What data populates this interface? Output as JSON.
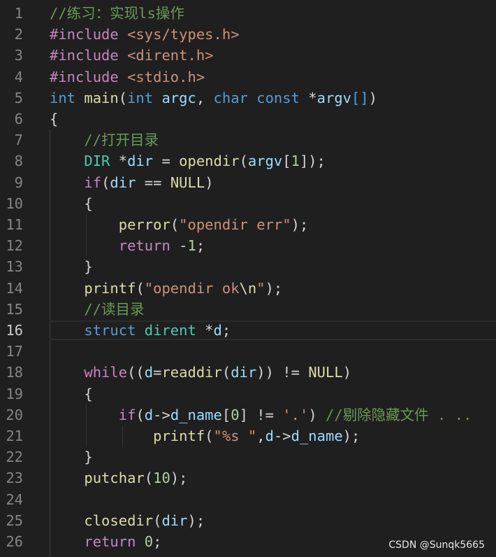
{
  "colors": {
    "background": "#1f1f1f",
    "line_number": "#858585",
    "active_line_number": "#cccccc",
    "comment": "#6a9955",
    "preprocessor": "#c586c0",
    "include_path": "#ce9178",
    "type_keyword": "#569cd6",
    "function": "#dcdcaa",
    "variable": "#9cdcfe",
    "string": "#ce9178",
    "number": "#b5cea8",
    "control_keyword": "#c586c0",
    "type_name": "#4ec9b0",
    "default_text": "#d4d4d4"
  },
  "current_line": 16,
  "watermark": "CSDN @Sunqk5665",
  "lines": [
    {
      "number": "1",
      "tokens": [
        {
          "t": "//练习：实现ls操作",
          "c": "comment"
        }
      ]
    },
    {
      "number": "2",
      "tokens": [
        {
          "t": "#include",
          "c": "preprocessor"
        },
        {
          "t": " ",
          "c": "default_text"
        },
        {
          "t": "<sys/types.h>",
          "c": "include_path"
        }
      ]
    },
    {
      "number": "3",
      "tokens": [
        {
          "t": "#include",
          "c": "preprocessor"
        },
        {
          "t": " ",
          "c": "default_text"
        },
        {
          "t": "<dirent.h>",
          "c": "include_path"
        }
      ]
    },
    {
      "number": "4",
      "tokens": [
        {
          "t": "#include",
          "c": "preprocessor"
        },
        {
          "t": " ",
          "c": "default_text"
        },
        {
          "t": "<stdio.h>",
          "c": "include_path"
        }
      ]
    },
    {
      "number": "5",
      "tokens": [
        {
          "t": "int",
          "c": "type_keyword"
        },
        {
          "t": " ",
          "c": "default_text"
        },
        {
          "t": "main",
          "c": "function"
        },
        {
          "t": "(",
          "c": "default_text"
        },
        {
          "t": "int",
          "c": "type_keyword"
        },
        {
          "t": " ",
          "c": "default_text"
        },
        {
          "t": "argc",
          "c": "variable"
        },
        {
          "t": ", ",
          "c": "default_text"
        },
        {
          "t": "char",
          "c": "type_keyword"
        },
        {
          "t": " ",
          "c": "default_text"
        },
        {
          "t": "const",
          "c": "type_keyword"
        },
        {
          "t": " *",
          "c": "default_text"
        },
        {
          "t": "argv",
          "c": "variable"
        },
        {
          "t": "[]",
          "c": "type_keyword"
        },
        {
          "t": ")",
          "c": "default_text"
        }
      ]
    },
    {
      "number": "6",
      "tokens": [
        {
          "t": "{",
          "c": "default_text"
        }
      ]
    },
    {
      "number": "7",
      "tokens": [
        {
          "t": "    ",
          "c": "default_text"
        },
        {
          "t": "//打开目录",
          "c": "comment"
        }
      ]
    },
    {
      "number": "8",
      "tokens": [
        {
          "t": "    ",
          "c": "default_text"
        },
        {
          "t": "DIR",
          "c": "type_name"
        },
        {
          "t": " *",
          "c": "default_text"
        },
        {
          "t": "dir",
          "c": "variable"
        },
        {
          "t": " = ",
          "c": "default_text"
        },
        {
          "t": "opendir",
          "c": "function"
        },
        {
          "t": "(",
          "c": "default_text"
        },
        {
          "t": "argv",
          "c": "variable"
        },
        {
          "t": "[",
          "c": "default_text"
        },
        {
          "t": "1",
          "c": "number"
        },
        {
          "t": "]);",
          "c": "default_text"
        }
      ]
    },
    {
      "number": "9",
      "tokens": [
        {
          "t": "    ",
          "c": "default_text"
        },
        {
          "t": "if",
          "c": "control_keyword"
        },
        {
          "t": "(",
          "c": "default_text"
        },
        {
          "t": "dir",
          "c": "variable"
        },
        {
          "t": " == ",
          "c": "default_text"
        },
        {
          "t": "NULL",
          "c": "function"
        },
        {
          "t": ")",
          "c": "default_text"
        }
      ]
    },
    {
      "number": "10",
      "tokens": [
        {
          "t": "    {",
          "c": "default_text"
        }
      ]
    },
    {
      "number": "11",
      "tokens": [
        {
          "t": "        ",
          "c": "default_text"
        },
        {
          "t": "perror",
          "c": "function"
        },
        {
          "t": "(",
          "c": "default_text"
        },
        {
          "t": "\"opendir err\"",
          "c": "string"
        },
        {
          "t": ");",
          "c": "default_text"
        }
      ]
    },
    {
      "number": "12",
      "tokens": [
        {
          "t": "        ",
          "c": "default_text"
        },
        {
          "t": "return",
          "c": "control_keyword"
        },
        {
          "t": " -",
          "c": "default_text"
        },
        {
          "t": "1",
          "c": "number"
        },
        {
          "t": ";",
          "c": "default_text"
        }
      ]
    },
    {
      "number": "13",
      "tokens": [
        {
          "t": "    }",
          "c": "default_text"
        }
      ]
    },
    {
      "number": "14",
      "tokens": [
        {
          "t": "    ",
          "c": "default_text"
        },
        {
          "t": "printf",
          "c": "function"
        },
        {
          "t": "(",
          "c": "default_text"
        },
        {
          "t": "\"opendir ok",
          "c": "string"
        },
        {
          "t": "\\n",
          "c": "function"
        },
        {
          "t": "\"",
          "c": "string"
        },
        {
          "t": ");",
          "c": "default_text"
        }
      ]
    },
    {
      "number": "15",
      "tokens": [
        {
          "t": "    ",
          "c": "default_text"
        },
        {
          "t": "//读目录",
          "c": "comment"
        }
      ]
    },
    {
      "number": "16",
      "tokens": [
        {
          "t": "    ",
          "c": "default_text"
        },
        {
          "t": "struct",
          "c": "type_keyword"
        },
        {
          "t": " ",
          "c": "default_text"
        },
        {
          "t": "dirent",
          "c": "type_name"
        },
        {
          "t": " *",
          "c": "default_text"
        },
        {
          "t": "d",
          "c": "variable"
        },
        {
          "t": ";",
          "c": "default_text"
        }
      ]
    },
    {
      "number": "17",
      "tokens": []
    },
    {
      "number": "18",
      "tokens": [
        {
          "t": "    ",
          "c": "default_text"
        },
        {
          "t": "while",
          "c": "control_keyword"
        },
        {
          "t": "((",
          "c": "default_text"
        },
        {
          "t": "d",
          "c": "variable"
        },
        {
          "t": "=",
          "c": "default_text"
        },
        {
          "t": "readdir",
          "c": "function"
        },
        {
          "t": "(",
          "c": "default_text"
        },
        {
          "t": "dir",
          "c": "variable"
        },
        {
          "t": ")) != ",
          "c": "default_text"
        },
        {
          "t": "NULL",
          "c": "function"
        },
        {
          "t": ")",
          "c": "default_text"
        }
      ]
    },
    {
      "number": "19",
      "tokens": [
        {
          "t": "    {",
          "c": "default_text"
        }
      ]
    },
    {
      "number": "20",
      "tokens": [
        {
          "t": "        ",
          "c": "default_text"
        },
        {
          "t": "if",
          "c": "control_keyword"
        },
        {
          "t": "(",
          "c": "default_text"
        },
        {
          "t": "d",
          "c": "variable"
        },
        {
          "t": "->",
          "c": "default_text"
        },
        {
          "t": "d_name",
          "c": "variable"
        },
        {
          "t": "[",
          "c": "default_text"
        },
        {
          "t": "0",
          "c": "number"
        },
        {
          "t": "] != ",
          "c": "default_text"
        },
        {
          "t": "'.'",
          "c": "string"
        },
        {
          "t": ") ",
          "c": "default_text"
        },
        {
          "t": "//剔除隐藏文件 . ..",
          "c": "comment"
        }
      ]
    },
    {
      "number": "21",
      "tokens": [
        {
          "t": "            ",
          "c": "default_text"
        },
        {
          "t": "printf",
          "c": "function"
        },
        {
          "t": "(",
          "c": "default_text"
        },
        {
          "t": "\"%s \"",
          "c": "string"
        },
        {
          "t": ",",
          "c": "default_text"
        },
        {
          "t": "d",
          "c": "variable"
        },
        {
          "t": "->",
          "c": "default_text"
        },
        {
          "t": "d_name",
          "c": "variable"
        },
        {
          "t": ");",
          "c": "default_text"
        }
      ]
    },
    {
      "number": "22",
      "tokens": [
        {
          "t": "    }",
          "c": "default_text"
        }
      ]
    },
    {
      "number": "23",
      "tokens": [
        {
          "t": "    ",
          "c": "default_text"
        },
        {
          "t": "putchar",
          "c": "function"
        },
        {
          "t": "(",
          "c": "default_text"
        },
        {
          "t": "10",
          "c": "number"
        },
        {
          "t": ");",
          "c": "default_text"
        }
      ]
    },
    {
      "number": "24",
      "tokens": []
    },
    {
      "number": "25",
      "tokens": [
        {
          "t": "    ",
          "c": "default_text"
        },
        {
          "t": "closedir",
          "c": "function"
        },
        {
          "t": "(",
          "c": "default_text"
        },
        {
          "t": "dir",
          "c": "variable"
        },
        {
          "t": ");",
          "c": "default_text"
        }
      ]
    },
    {
      "number": "26",
      "tokens": [
        {
          "t": "    ",
          "c": "default_text"
        },
        {
          "t": "return",
          "c": "control_keyword"
        },
        {
          "t": " ",
          "c": "default_text"
        },
        {
          "t": "0",
          "c": "number"
        },
        {
          "t": ";",
          "c": "default_text"
        }
      ]
    }
  ]
}
